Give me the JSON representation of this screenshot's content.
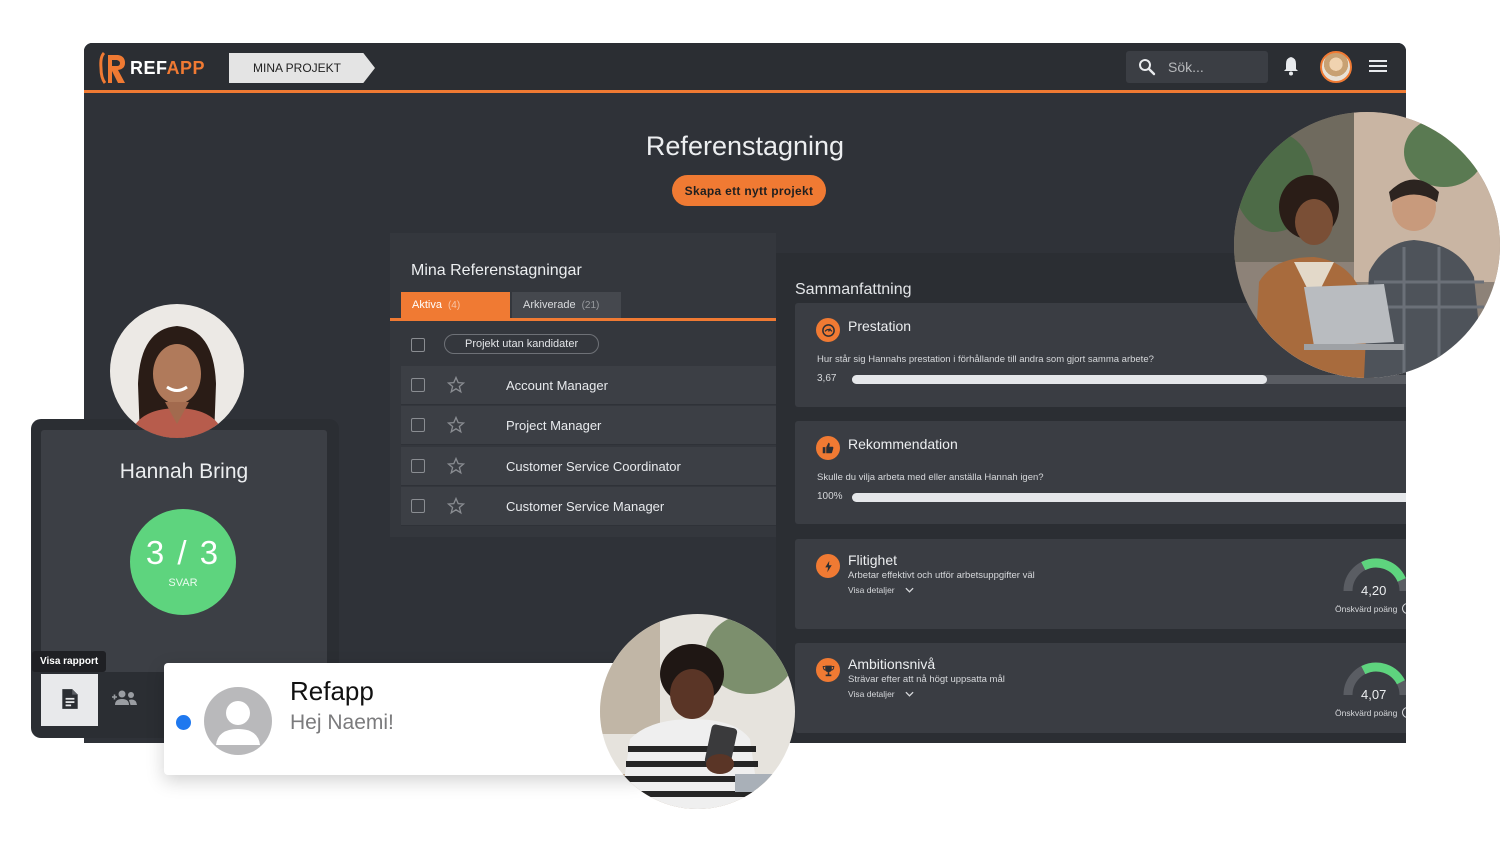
{
  "brand": {
    "name_ref": "REF",
    "name_app": "APP",
    "accent": "#f07a33"
  },
  "breadcrumb": "MINA PROJEKT",
  "search": {
    "placeholder": "Sök..."
  },
  "page": {
    "title": "Referenstagning",
    "new_project_label": "Skapa ett nytt projekt"
  },
  "list": {
    "title": "Mina Referenstagningar",
    "tabs": [
      {
        "label": "Aktiva",
        "count": "(4)"
      },
      {
        "label": "Arkiverade",
        "count": "(21)"
      }
    ],
    "filter_label": "Projekt utan kandidater",
    "projects": [
      "Account Manager",
      "Project Manager",
      "Customer Service Coordinator",
      "Customer Service Manager"
    ]
  },
  "summary": {
    "title": "Sammanfattning",
    "cards": [
      {
        "title": "Prestation",
        "question": "Hur står sig Hannahs prestation i förhållande till andra som gjort samma arbete?",
        "value_label": "3,67",
        "progress": 0.734
      },
      {
        "title": "Rekommendation",
        "question": "Skulle du vilja arbeta med eller anställa Hannah igen?",
        "value_label": "100%",
        "progress": 1.0
      },
      {
        "title": "Flitighet",
        "subtitle": "Arbetar effektivt och utför arbetsuppgifter väl",
        "details_label": "Visa detaljer",
        "score": "4,20",
        "score_value": 4.2,
        "score_caption": "Önskvärd poäng"
      },
      {
        "title": "Ambitionsnivå",
        "subtitle": "Strävar efter att nå högt uppsatta mål",
        "details_label": "Visa detaljer",
        "score": "4,07",
        "score_value": 4.07,
        "score_caption": "Önskvärd poäng"
      }
    ]
  },
  "candidate": {
    "name": "Hannah Bring",
    "score": "3 / 3",
    "score_label": "SVAR",
    "tooltip": "Visa rapport"
  },
  "notification": {
    "title": "Refapp",
    "message": "Hej Naemi!"
  },
  "colors": {
    "success": "#5ed47e",
    "notification_dot": "#1f78ef"
  }
}
